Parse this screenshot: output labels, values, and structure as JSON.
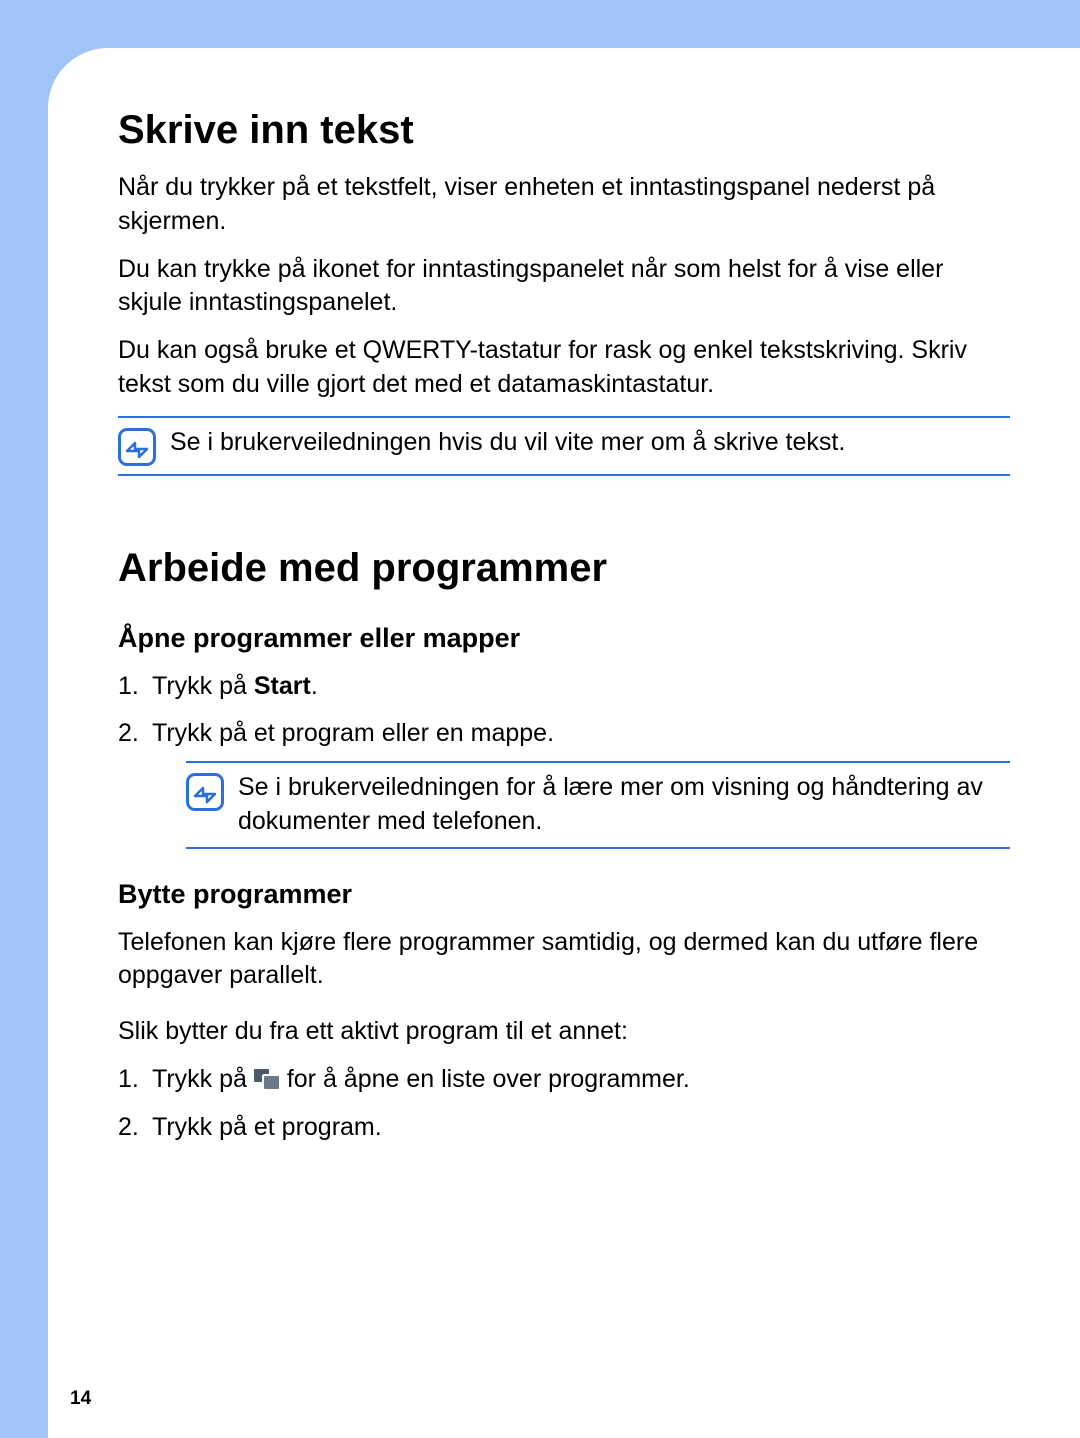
{
  "section1": {
    "heading": "Skrive inn tekst",
    "p1": "Når du trykker på et tekstfelt, viser enheten et inntastingspanel nederst på skjermen.",
    "p2": "Du kan trykke på ikonet for inntastingspanelet når som helst for å vise eller skjule inntastingspanelet.",
    "p3": "Du kan også bruke et QWERTY-tastatur for rask og enkel tekstskriving. Skriv tekst som du ville gjort det med et datamaskintastatur.",
    "note": "Se i brukerveiledningen hvis du vil vite mer om å skrive tekst."
  },
  "section2": {
    "heading": "Arbeide med programmer",
    "sub1": {
      "heading": "Åpne programmer eller mapper",
      "step1_pre": "Trykk på ",
      "step1_bold": "Start",
      "step1_post": ".",
      "step2": "Trykk på et program eller en mappe.",
      "note": "Se i brukerveiledningen for å lære mer om visning og håndtering av dokumenter med telefonen."
    },
    "sub2": {
      "heading": "Bytte programmer",
      "p1": "Telefonen kan kjøre flere programmer samtidig, og dermed kan du utføre flere oppgaver parallelt.",
      "p2": "Slik bytter du fra ett aktivt program til et annet:",
      "step1_pre": "Trykk på ",
      "step1_post": " for å åpne en liste over programmer.",
      "step2": "Trykk på et program."
    }
  },
  "pageNumber": "14"
}
